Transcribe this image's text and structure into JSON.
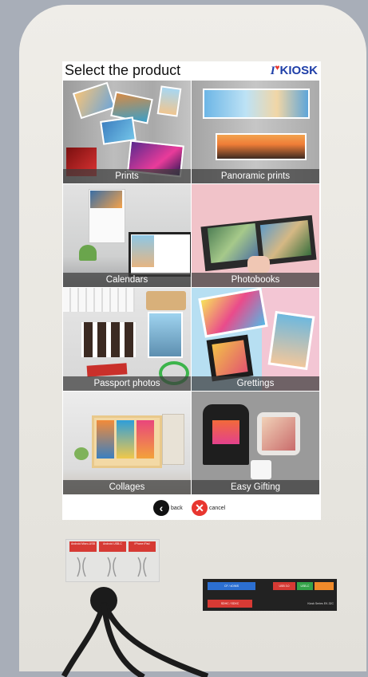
{
  "screen": {
    "title": "Select the product",
    "logo": {
      "prefix": "I",
      "heart": "♥",
      "word": "KIOSK"
    },
    "products": [
      {
        "label": "Prints"
      },
      {
        "label": "Panoramic prints"
      },
      {
        "label": "Calendars"
      },
      {
        "label": "Photobooks"
      },
      {
        "label": "Passport photos"
      },
      {
        "label": "Grettings"
      },
      {
        "label": "Collages"
      },
      {
        "label": "Easy Gifting"
      }
    ],
    "back_label": "back",
    "cancel_label": "cancel",
    "back_icon": "chevron-left-icon",
    "cancel_icon": "close-icon"
  },
  "hardware": {
    "port_labels": [
      "Android Micro-USB",
      "Android USB-C",
      "iPhone iPad"
    ],
    "card_reader_labels": [
      "CF / xD/MS",
      "USB 3.0",
      "USB-C",
      "SDHC / SDXC",
      "Kiosk Series EK-32C"
    ]
  },
  "colors": {
    "accent": "#e8362f",
    "logo_blue": "#1f3fa8",
    "label_bg": "#3c3c3c"
  }
}
